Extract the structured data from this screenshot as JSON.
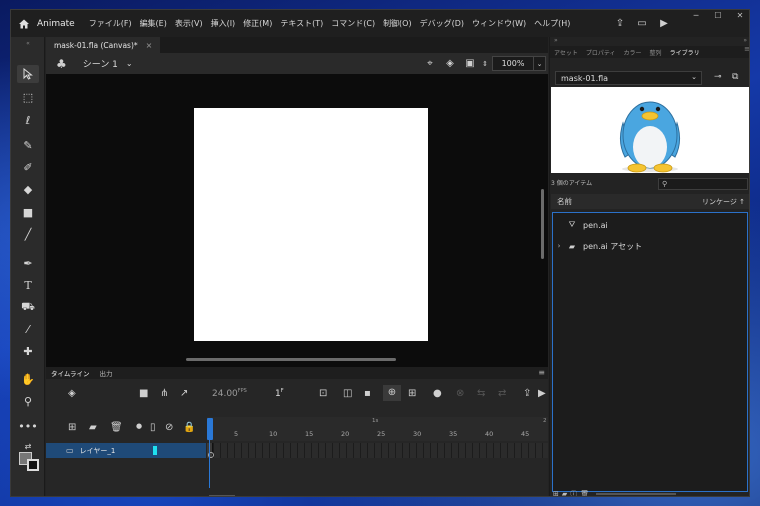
{
  "menubar": {
    "app_name": "Animate",
    "items": [
      "ファイル(F)",
      "編集(E)",
      "表示(V)",
      "挿入(I)",
      "修正(M)",
      "テキスト(T)",
      "コマンド(C)",
      "制御(O)",
      "デバッグ(D)",
      "ウィンドウ(W)",
      "ヘルプ(H)"
    ]
  },
  "document": {
    "tab_title": "mask-01.fla (Canvas)*",
    "close_glyph": "×",
    "scene_label": "シーン 1",
    "zoom": "100%"
  },
  "stage": {
    "background_color": "#0c0c0c",
    "canvas_color": "#ffffff"
  },
  "timeline": {
    "tabs": [
      "タイムライン",
      "出力"
    ],
    "fps": "24.00",
    "fps_unit": "FPS",
    "current_frame": "1",
    "frame_unit": "F",
    "ruler_marker": "1s",
    "ruler_marker2": "2",
    "ruler_labels": [
      "5",
      "10",
      "15",
      "20",
      "25",
      "30",
      "35",
      "40",
      "45"
    ],
    "layer": {
      "name": "レイヤー_1",
      "color": "#1fe0f0"
    }
  },
  "right_panel": {
    "tabs": [
      "アセット",
      "プロパティ",
      "カラー",
      "整列",
      "ライブラリ"
    ],
    "active_tab": "ライブラリ",
    "library_name": "mask-01.fla",
    "item_count": "3 個のアイテム",
    "col_name": "名前",
    "col_linkage": "リンケージ",
    "items": [
      {
        "name": "pen.ai",
        "icon": "graphic-symbol-icon",
        "expandable": false
      },
      {
        "name": "pen.ai アセット",
        "icon": "folder-icon",
        "expandable": true
      }
    ]
  },
  "colors": {
    "accent": "#2a78d6",
    "panel_bg": "#232323",
    "penguin_blue": "#4aa6e0",
    "penguin_beak": "#f5c431"
  }
}
